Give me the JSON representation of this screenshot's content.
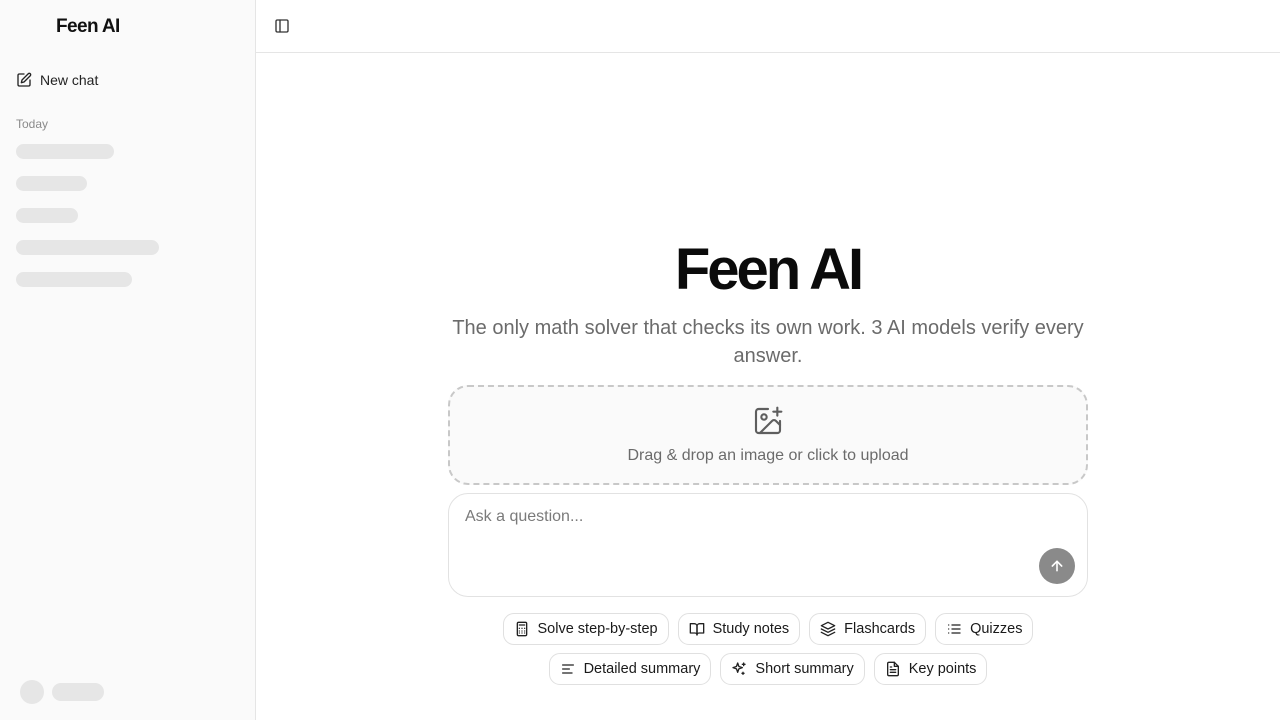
{
  "sidebar": {
    "brand": "Feen AI",
    "new_chat_label": "New chat",
    "section_label": "Today"
  },
  "main": {
    "title": "Feen AI",
    "subtitle": "The only math solver that checks its own work. 3 AI models verify every answer.",
    "dropzone_text": "Drag & drop an image or click to upload",
    "input_placeholder": "Ask a question...",
    "input_value": ""
  },
  "chips": [
    {
      "label": "Solve step-by-step",
      "icon": "calculator-icon"
    },
    {
      "label": "Study notes",
      "icon": "book-open-icon"
    },
    {
      "label": "Flashcards",
      "icon": "layers-icon"
    },
    {
      "label": "Quizzes",
      "icon": "list-icon"
    },
    {
      "label": "Detailed summary",
      "icon": "align-left-icon"
    },
    {
      "label": "Short summary",
      "icon": "sparkles-icon"
    },
    {
      "label": "Key points",
      "icon": "file-text-icon"
    }
  ],
  "colors": {
    "sidebar_bg": "#fafafa",
    "skeleton": "#e6e6e6",
    "send_button": "#8a8a8a",
    "border": "#e5e5e5"
  }
}
